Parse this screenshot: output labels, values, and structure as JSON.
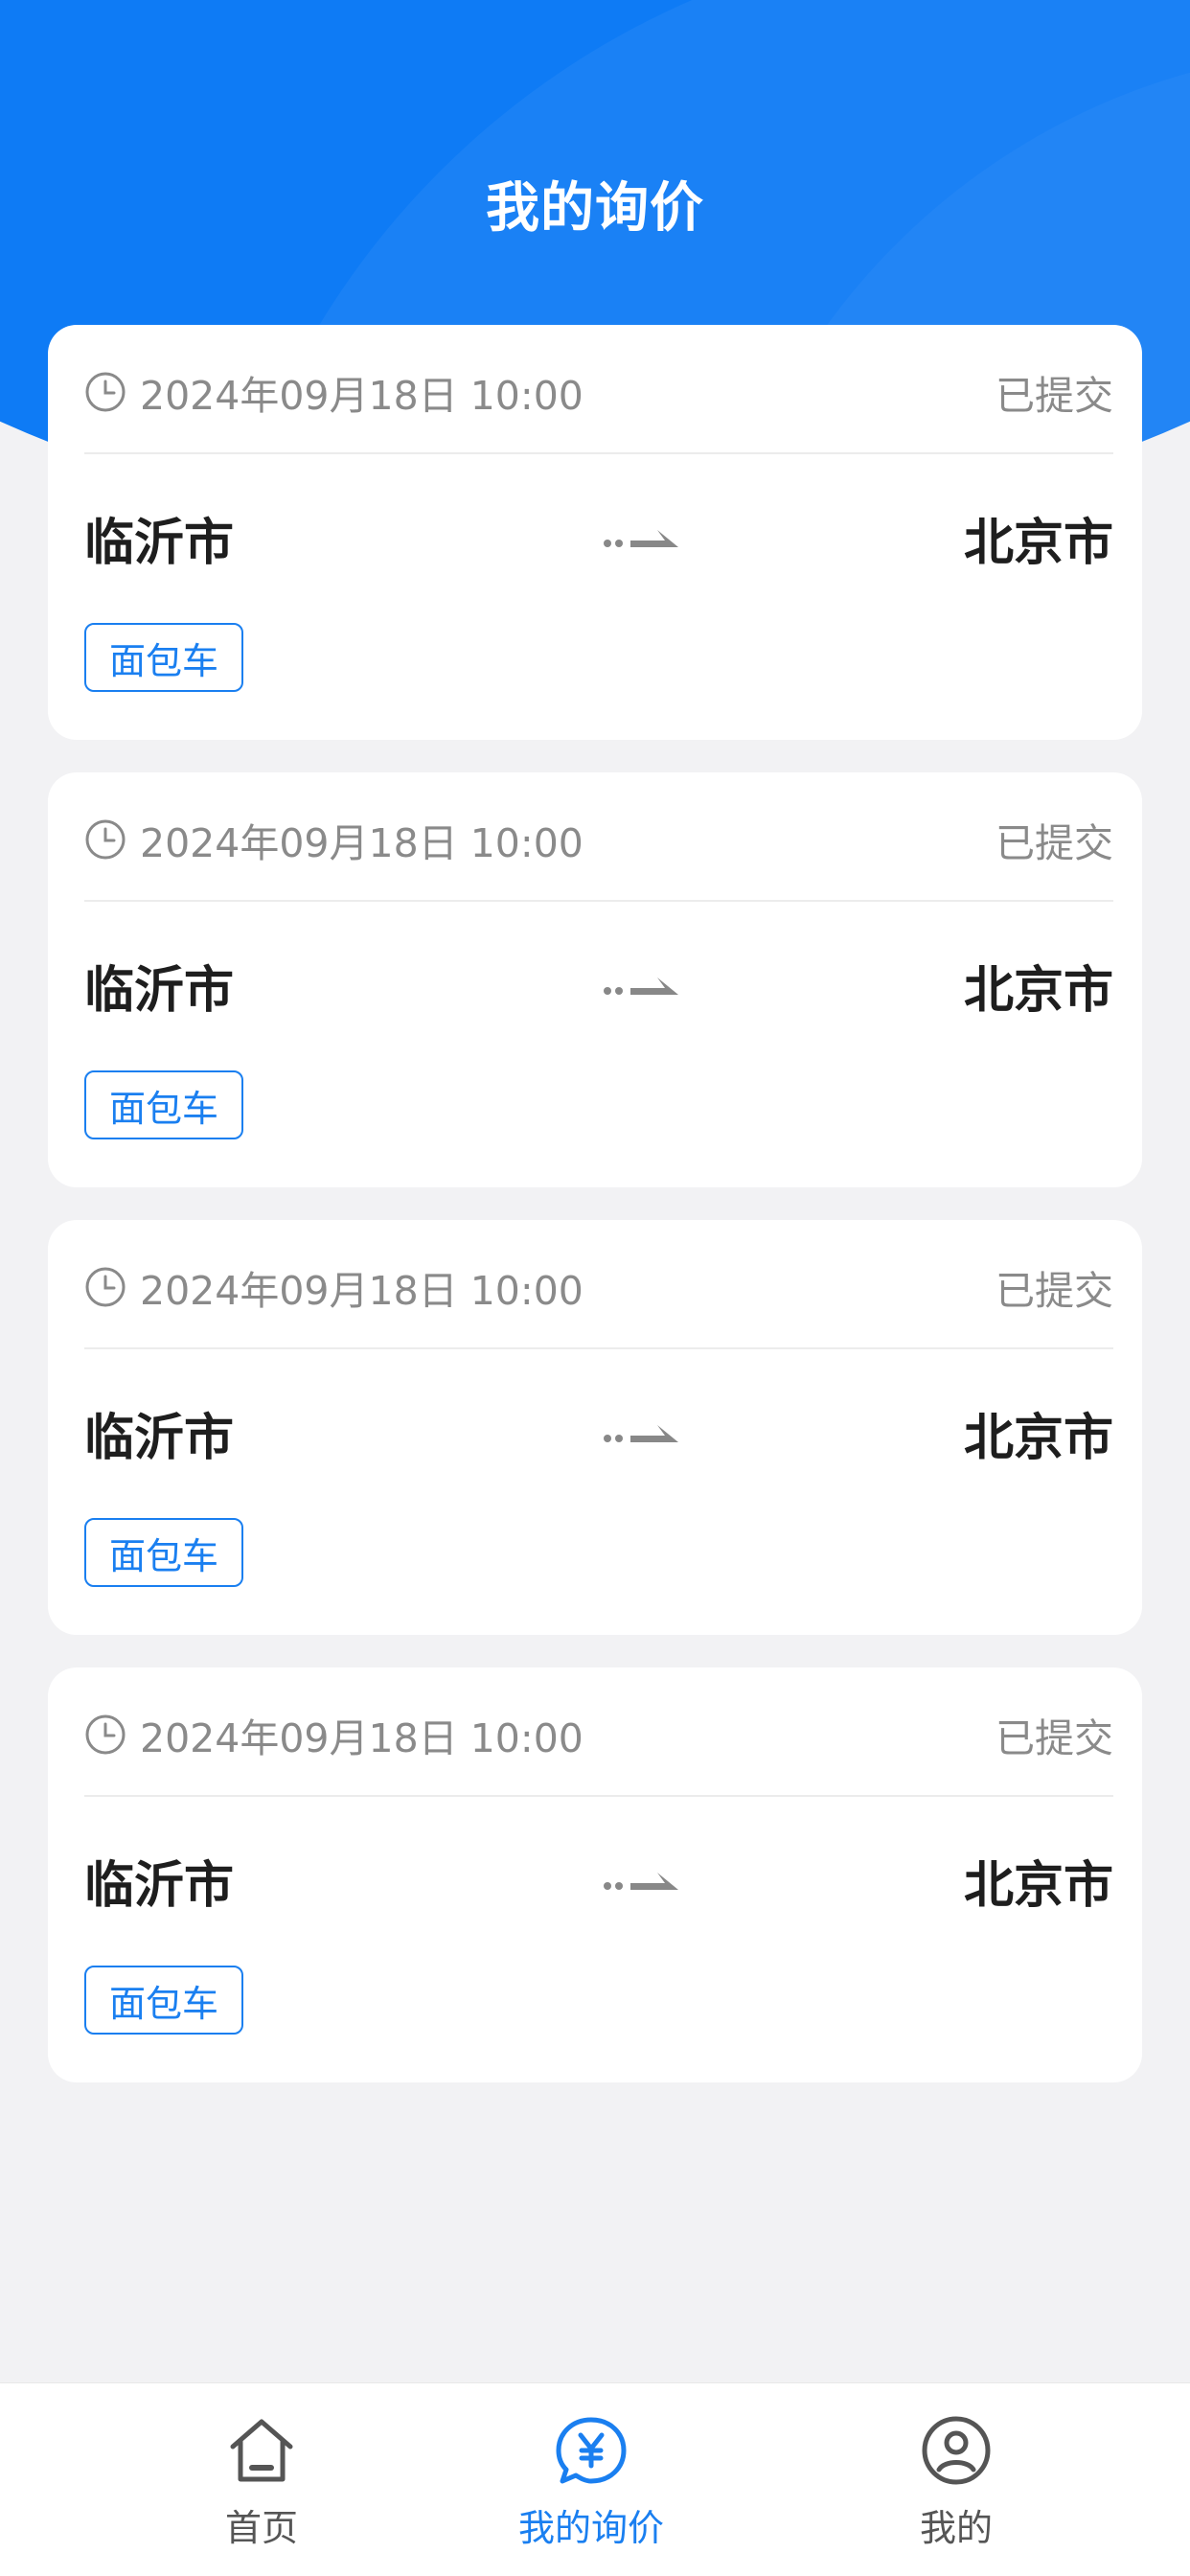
{
  "header": {
    "title": "我的询价"
  },
  "inquiries": [
    {
      "time": "2024年09月18日 10:00",
      "status": "已提交",
      "from": "临沂市",
      "to": "北京市",
      "vehicle": "面包车"
    },
    {
      "time": "2024年09月18日 10:00",
      "status": "已提交",
      "from": "临沂市",
      "to": "北京市",
      "vehicle": "面包车"
    },
    {
      "time": "2024年09月18日 10:00",
      "status": "已提交",
      "from": "临沂市",
      "to": "北京市",
      "vehicle": "面包车"
    },
    {
      "time": "2024年09月18日 10:00",
      "status": "已提交",
      "from": "临沂市",
      "to": "北京市",
      "vehicle": "面包车"
    }
  ],
  "tabbar": {
    "items": [
      {
        "label": "首页",
        "icon": "home-icon",
        "active": false
      },
      {
        "label": "我的询价",
        "icon": "yen-chat-icon",
        "active": true
      },
      {
        "label": "我的",
        "icon": "user-icon",
        "active": false
      }
    ]
  },
  "colors": {
    "primary": "#0e7bf5",
    "background": "#f2f2f4",
    "muted_text": "#8a8a8a",
    "tag_blue": "#1a7ff0"
  }
}
